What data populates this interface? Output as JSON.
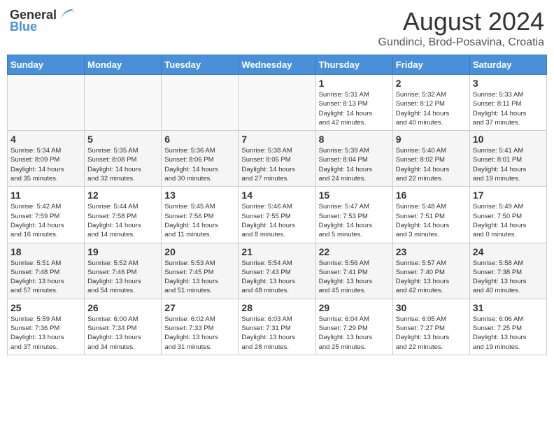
{
  "header": {
    "logo_general": "General",
    "logo_blue": "Blue",
    "title": "August 2024",
    "subtitle": "Gundinci, Brod-Posavina, Croatia"
  },
  "days_of_week": [
    "Sunday",
    "Monday",
    "Tuesday",
    "Wednesday",
    "Thursday",
    "Friday",
    "Saturday"
  ],
  "weeks": [
    [
      {
        "day": "",
        "info": ""
      },
      {
        "day": "",
        "info": ""
      },
      {
        "day": "",
        "info": ""
      },
      {
        "day": "",
        "info": ""
      },
      {
        "day": "1",
        "info": "Sunrise: 5:31 AM\nSunset: 8:13 PM\nDaylight: 14 hours\nand 42 minutes."
      },
      {
        "day": "2",
        "info": "Sunrise: 5:32 AM\nSunset: 8:12 PM\nDaylight: 14 hours\nand 40 minutes."
      },
      {
        "day": "3",
        "info": "Sunrise: 5:33 AM\nSunset: 8:11 PM\nDaylight: 14 hours\nand 37 minutes."
      }
    ],
    [
      {
        "day": "4",
        "info": "Sunrise: 5:34 AM\nSunset: 8:09 PM\nDaylight: 14 hours\nand 35 minutes."
      },
      {
        "day": "5",
        "info": "Sunrise: 5:35 AM\nSunset: 8:08 PM\nDaylight: 14 hours\nand 32 minutes."
      },
      {
        "day": "6",
        "info": "Sunrise: 5:36 AM\nSunset: 8:06 PM\nDaylight: 14 hours\nand 30 minutes."
      },
      {
        "day": "7",
        "info": "Sunrise: 5:38 AM\nSunset: 8:05 PM\nDaylight: 14 hours\nand 27 minutes."
      },
      {
        "day": "8",
        "info": "Sunrise: 5:39 AM\nSunset: 8:04 PM\nDaylight: 14 hours\nand 24 minutes."
      },
      {
        "day": "9",
        "info": "Sunrise: 5:40 AM\nSunset: 8:02 PM\nDaylight: 14 hours\nand 22 minutes."
      },
      {
        "day": "10",
        "info": "Sunrise: 5:41 AM\nSunset: 8:01 PM\nDaylight: 14 hours\nand 19 minutes."
      }
    ],
    [
      {
        "day": "11",
        "info": "Sunrise: 5:42 AM\nSunset: 7:59 PM\nDaylight: 14 hours\nand 16 minutes."
      },
      {
        "day": "12",
        "info": "Sunrise: 5:44 AM\nSunset: 7:58 PM\nDaylight: 14 hours\nand 14 minutes."
      },
      {
        "day": "13",
        "info": "Sunrise: 5:45 AM\nSunset: 7:56 PM\nDaylight: 14 hours\nand 11 minutes."
      },
      {
        "day": "14",
        "info": "Sunrise: 5:46 AM\nSunset: 7:55 PM\nDaylight: 14 hours\nand 8 minutes."
      },
      {
        "day": "15",
        "info": "Sunrise: 5:47 AM\nSunset: 7:53 PM\nDaylight: 14 hours\nand 5 minutes."
      },
      {
        "day": "16",
        "info": "Sunrise: 5:48 AM\nSunset: 7:51 PM\nDaylight: 14 hours\nand 3 minutes."
      },
      {
        "day": "17",
        "info": "Sunrise: 5:49 AM\nSunset: 7:50 PM\nDaylight: 14 hours\nand 0 minutes."
      }
    ],
    [
      {
        "day": "18",
        "info": "Sunrise: 5:51 AM\nSunset: 7:48 PM\nDaylight: 13 hours\nand 57 minutes."
      },
      {
        "day": "19",
        "info": "Sunrise: 5:52 AM\nSunset: 7:46 PM\nDaylight: 13 hours\nand 54 minutes."
      },
      {
        "day": "20",
        "info": "Sunrise: 5:53 AM\nSunset: 7:45 PM\nDaylight: 13 hours\nand 51 minutes."
      },
      {
        "day": "21",
        "info": "Sunrise: 5:54 AM\nSunset: 7:43 PM\nDaylight: 13 hours\nand 48 minutes."
      },
      {
        "day": "22",
        "info": "Sunrise: 5:56 AM\nSunset: 7:41 PM\nDaylight: 13 hours\nand 45 minutes."
      },
      {
        "day": "23",
        "info": "Sunrise: 5:57 AM\nSunset: 7:40 PM\nDaylight: 13 hours\nand 42 minutes."
      },
      {
        "day": "24",
        "info": "Sunrise: 5:58 AM\nSunset: 7:38 PM\nDaylight: 13 hours\nand 40 minutes."
      }
    ],
    [
      {
        "day": "25",
        "info": "Sunrise: 5:59 AM\nSunset: 7:36 PM\nDaylight: 13 hours\nand 37 minutes."
      },
      {
        "day": "26",
        "info": "Sunrise: 6:00 AM\nSunset: 7:34 PM\nDaylight: 13 hours\nand 34 minutes."
      },
      {
        "day": "27",
        "info": "Sunrise: 6:02 AM\nSunset: 7:33 PM\nDaylight: 13 hours\nand 31 minutes."
      },
      {
        "day": "28",
        "info": "Sunrise: 6:03 AM\nSunset: 7:31 PM\nDaylight: 13 hours\nand 28 minutes."
      },
      {
        "day": "29",
        "info": "Sunrise: 6:04 AM\nSunset: 7:29 PM\nDaylight: 13 hours\nand 25 minutes."
      },
      {
        "day": "30",
        "info": "Sunrise: 6:05 AM\nSunset: 7:27 PM\nDaylight: 13 hours\nand 22 minutes."
      },
      {
        "day": "31",
        "info": "Sunrise: 6:06 AM\nSunset: 7:25 PM\nDaylight: 13 hours\nand 19 minutes."
      }
    ]
  ]
}
